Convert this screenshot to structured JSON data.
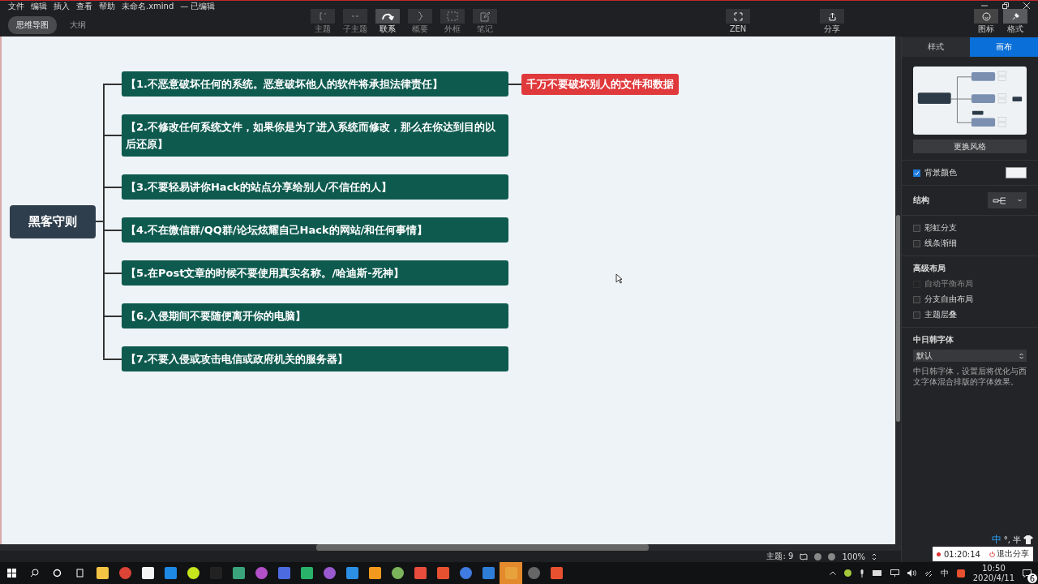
{
  "menu": [
    "文件",
    "编辑",
    "插入",
    "查看",
    "帮助"
  ],
  "document": {
    "title": "未命名.xmind",
    "status": "— 已编辑"
  },
  "view_tabs": [
    {
      "label": "思维导图",
      "selected": true
    },
    {
      "label": "大纲",
      "selected": false
    }
  ],
  "toolbar": [
    {
      "kind": "topic",
      "label": "主题",
      "selected": false
    },
    {
      "kind": "subtopic",
      "label": "子主题",
      "selected": false
    },
    {
      "kind": "relation",
      "label": "联系",
      "selected": true
    },
    {
      "kind": "summary",
      "label": "概要",
      "selected": false
    },
    {
      "kind": "boundary",
      "label": "外框",
      "selected": false
    },
    {
      "kind": "note",
      "label": "笔记",
      "selected": false
    }
  ],
  "zen": {
    "label": "ZEN"
  },
  "share": {
    "label": "分享"
  },
  "panel_toggles": [
    {
      "kind": "icon",
      "label": "图标",
      "selected": false
    },
    {
      "kind": "format",
      "label": "格式",
      "selected": true
    }
  ],
  "mindmap": {
    "central": "黑客守则",
    "branches": [
      {
        "text": "【1.不恶意破坏任何的系统。恶意破坏他人的软件将承担法律责任】",
        "callout": "千万不要破坏别人的文件和数据"
      },
      {
        "text": "【2.不修改任何系统文件，如果你是为了进入系统而修改，那么在你达到目的以后还原】"
      },
      {
        "text": "【3.不要轻易讲你Hack的站点分享给别人/不信任的人】"
      },
      {
        "text": "【4.不在微信群/QQ群/论坛炫耀自己Hack的网站/和任何事情】"
      },
      {
        "text": "【5.在Post文章的时候不要使用真实名称。/哈迪斯-死神】"
      },
      {
        "text": "【6.入侵期间不要随便离开你的电脑】"
      },
      {
        "text": "【7.不要入侵或攻击电信或政府机关的服务器】"
      }
    ]
  },
  "panel": {
    "tabs": [
      {
        "label": "样式",
        "selected": false
      },
      {
        "label": "画布",
        "selected": true
      }
    ],
    "style_button": "更换风格",
    "background": {
      "label": "背景颜色",
      "checked": true
    },
    "structure": {
      "label": "结构"
    },
    "options": [
      {
        "label": "彩虹分支",
        "checked": false
      },
      {
        "label": "线条渐细",
        "checked": false
      }
    ],
    "advanced": {
      "title": "高级布局",
      "options": [
        {
          "label": "自动平衡布局",
          "checked": false,
          "disabled": true
        },
        {
          "label": "分支自由布局",
          "checked": false,
          "disabled": false
        },
        {
          "label": "主题层叠",
          "checked": false,
          "disabled": false
        }
      ]
    },
    "cjk_font": {
      "title": "中日韩字体",
      "value": "默认",
      "description": "中日韩字体，设置后将优化与西文字体混合排版的字体效果。"
    }
  },
  "status_bar": {
    "topics": "主题: 9",
    "zoom": "100%"
  },
  "ime": {
    "mode": "中",
    "punct": "°,",
    "width": "半"
  },
  "share_overlay": {
    "timer": "01:20:14",
    "stop": "退出分享"
  },
  "taskbar": {
    "ime": "中",
    "time": "10:50",
    "date": "2020/4/11",
    "notifications": "6"
  }
}
